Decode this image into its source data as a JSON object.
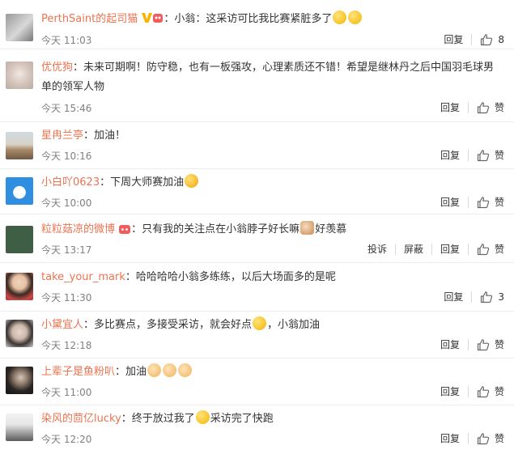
{
  "comments": [
    {
      "user": "PerthSaint的起司猫",
      "colon": "：",
      "text_parts": [
        "小翁：这采访可比我比赛紧脏多了"
      ],
      "emojis": [
        "laugh-cry",
        "laugh-cry"
      ],
      "time": "今天 11:03",
      "actions": [
        "回复"
      ],
      "likes": "8",
      "vip": true
    },
    {
      "user": "优优狗",
      "colon": "：",
      "line1": "未来可期啊！防守稳，也有一板强攻，心理素质还不错！希望是继林丹之后中国羽毛球男",
      "line2": "单的领军人物",
      "time": "今天 15:46",
      "actions": [
        "回复"
      ],
      "likes": "赞"
    },
    {
      "user": "星冉兰亭",
      "colon": "：",
      "text": "加油！",
      "time": "今天 10:16",
      "actions": [
        "回复"
      ],
      "likes": "赞"
    },
    {
      "user": "小白吖0623",
      "colon": "：",
      "text": "下周大师赛加油",
      "time": "今天 10:00",
      "actions": [
        "回复"
      ],
      "likes": "赞"
    },
    {
      "user": "粒粒菇凉的微博",
      "colon": "：",
      "text_before": "只有我的关注点在小翁脖子好长嘛",
      "text_after": "好羡慕",
      "time": "今天 13:17",
      "actions": [
        "投诉",
        "屏蔽",
        "回复"
      ],
      "likes": "赞"
    },
    {
      "user": "take_your_mark",
      "colon": "：",
      "text": "哈哈哈哈小翁多练练，以后大场面多的是呢",
      "time": "今天 11:30",
      "actions": [
        "回复"
      ],
      "likes": "3"
    },
    {
      "user": "小黛宜人",
      "colon": "：",
      "text_before": "多比赛点，多接受采访，就会好点",
      "text_after": "，小翁加油",
      "time": "今天 12:18",
      "actions": [
        "回复"
      ],
      "likes": "赞"
    },
    {
      "user": "上辈子是鱼粉叭",
      "colon": "：",
      "text": "加油",
      "time": "今天 11:00",
      "actions": [
        "回复"
      ],
      "likes": "赞"
    },
    {
      "user": "染风的茴亿lucky",
      "colon": "：",
      "text_before": "终于放过我了",
      "text_after": "采访完了快跑",
      "time": "今天 12:20",
      "actions": [
        "回复"
      ],
      "likes": "赞"
    }
  ],
  "colors": {
    "username": "#eb7350",
    "time": "#808080",
    "divider": "#ececec"
  },
  "icons": {
    "like": "thumbs-up-icon",
    "vip": "vip-badge-icon"
  }
}
